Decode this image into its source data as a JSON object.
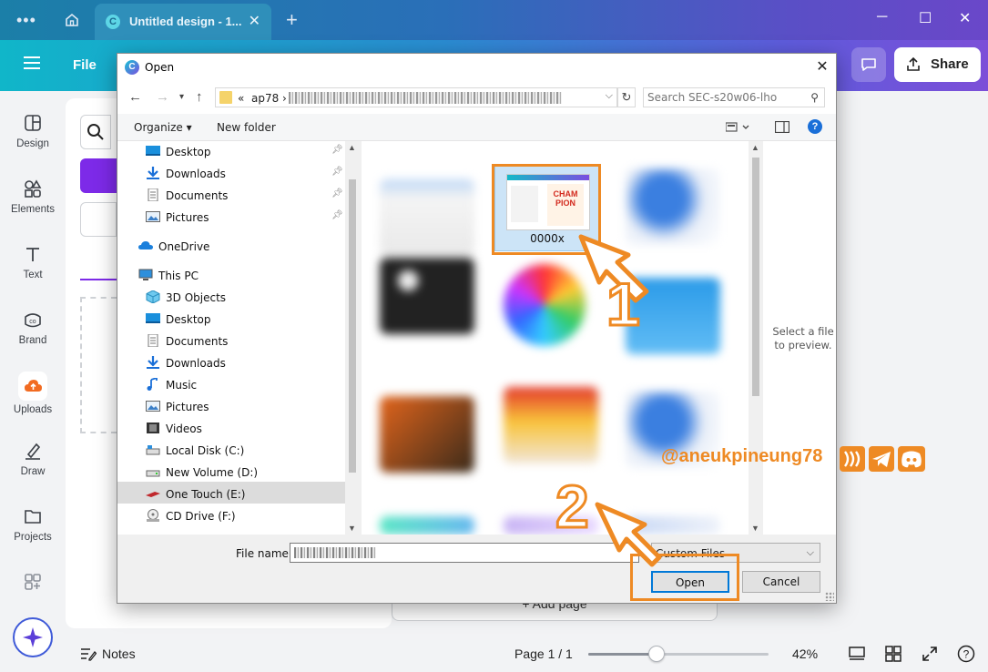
{
  "browser": {
    "tab_title": "Untitled design - 1...",
    "tab_logo": "C"
  },
  "header": {
    "file_menu": "File",
    "share_label": "Share"
  },
  "rail": {
    "items": [
      {
        "label": "Design",
        "icon": "design-icon"
      },
      {
        "label": "Elements",
        "icon": "elements-icon"
      },
      {
        "label": "Text",
        "icon": "text-icon"
      },
      {
        "label": "Brand",
        "icon": "brand-icon"
      },
      {
        "label": "Uploads",
        "icon": "uploads-icon"
      },
      {
        "label": "Draw",
        "icon": "draw-icon"
      },
      {
        "label": "Projects",
        "icon": "projects-icon"
      },
      {
        "label": "",
        "icon": "apps-icon"
      }
    ]
  },
  "canvas": {
    "add_page": "+ Add page"
  },
  "bottombar": {
    "notes": "Notes",
    "page_info": "Page 1 / 1",
    "zoom_value": "42%",
    "zoom_fraction": 0.38
  },
  "dialog": {
    "title": "Open",
    "path_prefix": "«",
    "path_folder": "ap78",
    "search_placeholder": "Search SEC-s20w06-lho",
    "organize": "Organize ▾",
    "new_folder": "New folder",
    "tree": [
      {
        "label": "Desktop",
        "icon": "desktop-icon",
        "pinned": true
      },
      {
        "label": "Downloads",
        "icon": "downloads-icon",
        "pinned": true
      },
      {
        "label": "Documents",
        "icon": "documents-icon",
        "pinned": true
      },
      {
        "label": "Pictures",
        "icon": "pictures-icon",
        "pinned": true
      },
      {
        "label": "OneDrive",
        "icon": "onedrive-icon",
        "pinned": false
      },
      {
        "label": "This PC",
        "icon": "this-pc-icon",
        "pinned": false
      },
      {
        "label": "3D Objects",
        "icon": "3d-objects-icon",
        "pinned": false
      },
      {
        "label": "Desktop",
        "icon": "desktop-icon",
        "pinned": false
      },
      {
        "label": "Documents",
        "icon": "documents-icon",
        "pinned": false
      },
      {
        "label": "Downloads",
        "icon": "downloads-icon",
        "pinned": false
      },
      {
        "label": "Music",
        "icon": "music-icon",
        "pinned": false
      },
      {
        "label": "Pictures",
        "icon": "pictures-icon",
        "pinned": false
      },
      {
        "label": "Videos",
        "icon": "videos-icon",
        "pinned": false
      },
      {
        "label": "Local Disk (C:)",
        "icon": "disk-icon",
        "pinned": false
      },
      {
        "label": "New Volume (D:)",
        "icon": "disk-icon",
        "pinned": false
      },
      {
        "label": "One Touch (E:)",
        "icon": "usb-drive-icon",
        "pinned": false,
        "selected": true
      },
      {
        "label": "CD Drive (F:)",
        "icon": "cd-drive-icon",
        "pinned": false
      }
    ],
    "selected_file": "0000x",
    "selected_thumb_text": "CHAM PION",
    "preview_text": "Select a file to preview.",
    "file_name_label": "File name:",
    "file_type": "Custom Files",
    "open_label": "Open",
    "cancel_label": "Cancel"
  },
  "annotations": {
    "step1": "1",
    "step2": "2",
    "watermark": "@aneukpineung78",
    "accent": "#ee8a24"
  }
}
